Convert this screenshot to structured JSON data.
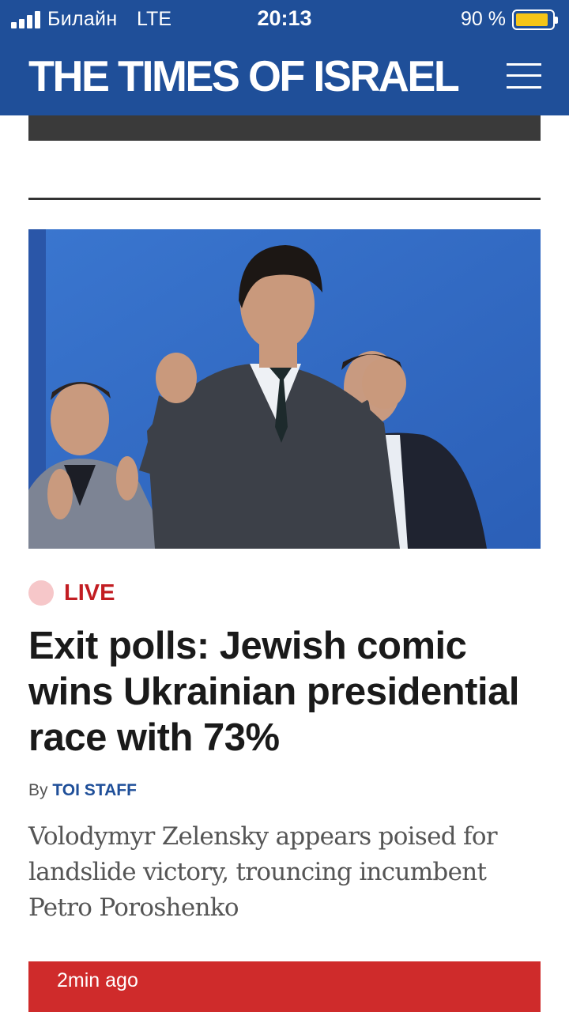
{
  "status_bar": {
    "carrier": "Билайн",
    "network": "LTE",
    "time": "20:13",
    "battery": "90 %",
    "battery_level": 0.9
  },
  "header": {
    "logo": "THE TIMES OF ISRAEL",
    "menu_icon": "hamburger-menu-icon"
  },
  "article": {
    "live_label": "LIVE",
    "headline": "Exit polls: Jewish comic wins Ukrainian presidential race with 73%",
    "byline_prefix": "By",
    "author": "TOI STAFF",
    "summary": "Volodymyr Zelensky appears poised for landslide victory, trouncing incumbent Petro Poroshenko"
  },
  "live_feed": {
    "time_ago": "2min ago"
  },
  "colors": {
    "header_bg": "#1f4f99",
    "live_red": "#c21d22",
    "live_dot": "#f6c7c9",
    "author_blue": "#1f4f99",
    "live_card_bg": "#cf2b2b",
    "battery_yellow": "#f5c518"
  }
}
